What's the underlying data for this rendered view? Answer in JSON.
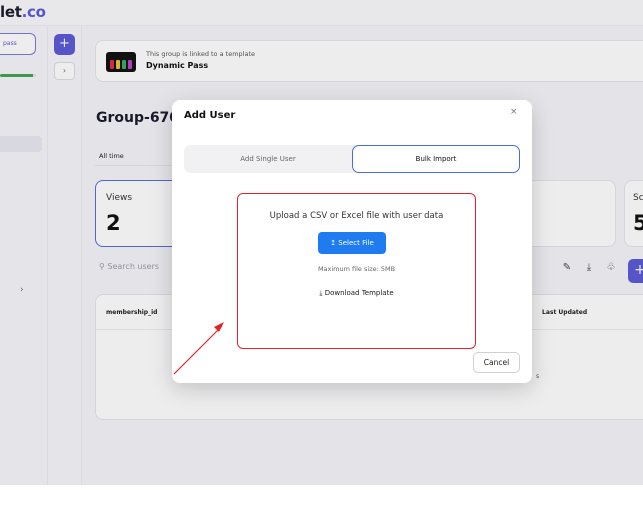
{
  "brand": {
    "logo_main": "let",
    "logo_accent": ".co"
  },
  "sidebar": {
    "pass_button": "pass",
    "progress_fraction": 0.92
  },
  "banner": {
    "line1": "This group is linked to a template",
    "line2": "Dynamic Pass"
  },
  "page": {
    "title": "Group-670",
    "time_filter": "All time",
    "views_label": "Views",
    "views_value": "2",
    "card3_label": "Sc",
    "card3_value": "5",
    "search_placeholder": "Search users",
    "table_col_membership": "membership_id",
    "table_col_updated": "Last Updated",
    "table_trailing_text": "s"
  },
  "modal": {
    "title": "Add User",
    "close": "×",
    "tab_single": "Add Single User",
    "tab_bulk": "Bulk Import",
    "upload_text": "Upload a CSV or Excel file with user data",
    "select_file": "Select File",
    "max_size": "Maximum file size: 5MB",
    "download_template": "Download Template",
    "cancel": "Cancel"
  },
  "colors": {
    "accent": "#5b5bd6",
    "select_button": "#1f7cf0",
    "highlight_border": "#e0242f",
    "active_tab_border": "#4a6ed8"
  },
  "icons": {
    "upload": "upload-icon",
    "download": "download-icon",
    "edit": "edit-icon",
    "bell": "bell-icon",
    "search": "search-icon",
    "plus": "plus-icon"
  }
}
